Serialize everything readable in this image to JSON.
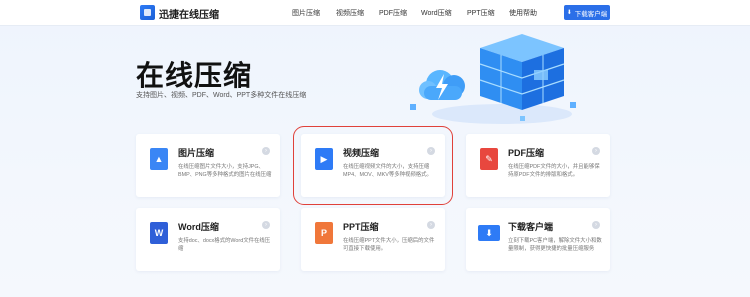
{
  "header": {
    "logo_text": "迅捷在线压缩",
    "nav": [
      "图片压缩",
      "视频压缩",
      "PDF压缩",
      "Word压缩",
      "PPT压缩",
      "使用帮助"
    ],
    "download_label": "下载客户端"
  },
  "hero": {
    "title": "在线压缩",
    "subtitle": "支持图片、视频、PDF、Word、PPT多种文件在线压缩"
  },
  "cards": [
    {
      "title": "图片压缩",
      "desc": "在线压缩图片文件大小，支持JPG、BMP、PNG等多种格式的图片在线压缩",
      "icon": "image-file-icon",
      "color": "#3a86f5"
    },
    {
      "title": "视频压缩",
      "desc": "在线压缩视频文件的大小，支持压缩MP4、MOV、MKV等多种视频格式。",
      "icon": "video-file-icon",
      "color": "#2e7bf6"
    },
    {
      "title": "PDF压缩",
      "desc": "在线压缩PDF文件的大小，并且能够保持原PDF文件的排版和格式。",
      "icon": "pdf-file-icon",
      "color": "#e8473e"
    },
    {
      "title": "Word压缩",
      "desc": "支持doc、docx格式的Word文件在线压缩",
      "icon": "word-file-icon",
      "color": "#2f5fd8"
    },
    {
      "title": "PPT压缩",
      "desc": "在线压缩PPT文件大小，压缩后的文件可直接下载使用。",
      "icon": "ppt-file-icon",
      "color": "#f0773a"
    },
    {
      "title": "下载客户端",
      "desc": "立刻下载PC客户端，解除文件大小和数量限制，获得更快捷的批量压缩服务",
      "icon": "monitor-download-icon",
      "color": "#2e7bf6"
    }
  ],
  "colors": {
    "accent": "#2b6fe8",
    "highlight": "#e0413a"
  }
}
